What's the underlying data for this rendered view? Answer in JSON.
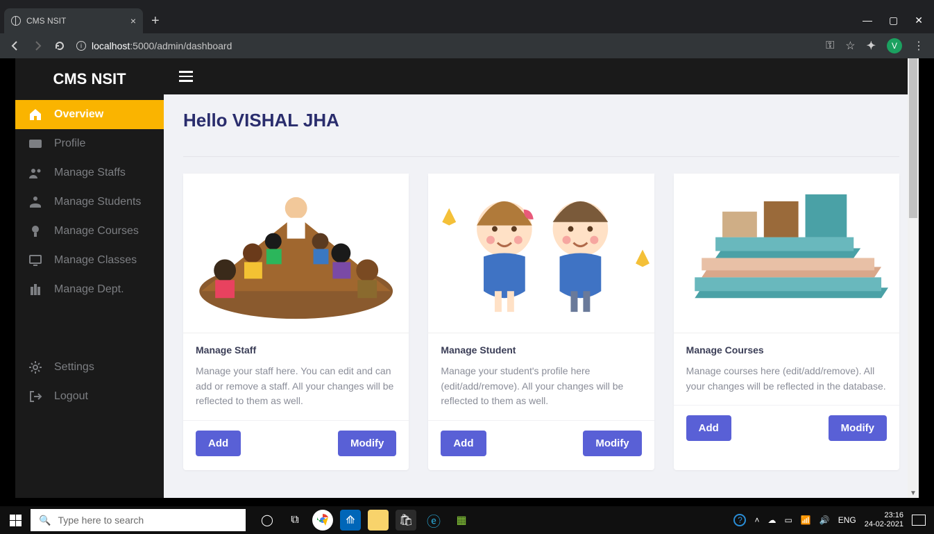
{
  "browser": {
    "tab_title": "CMS NSIT",
    "url_host": "localhost",
    "url_port_path": ":5000/admin/dashboard",
    "avatar_letter": "V"
  },
  "sidebar": {
    "brand": "CMS NSIT",
    "items": [
      {
        "label": "Overview"
      },
      {
        "label": "Profile"
      },
      {
        "label": "Manage Staffs"
      },
      {
        "label": "Manage Students"
      },
      {
        "label": "Manage Courses"
      },
      {
        "label": "Manage Classes"
      },
      {
        "label": "Manage Dept."
      }
    ],
    "footer_items": [
      {
        "label": "Settings"
      },
      {
        "label": "Logout"
      }
    ]
  },
  "main": {
    "greeting": "Hello VISHAL JHA",
    "cards": [
      {
        "title": "Manage Staff",
        "text": "Manage your staff here. You can edit and can add or remove a staff. All your changes will be reflected to them as well.",
        "add_label": "Add",
        "modify_label": "Modify"
      },
      {
        "title": "Manage Student",
        "text": "Manage your student's profile here (edit/add/remove). All your changes will be reflected to them as well.",
        "add_label": "Add",
        "modify_label": "Modify"
      },
      {
        "title": "Manage Courses",
        "text": "Manage courses here (edit/add/remove). All your changes will be reflected in the database.",
        "add_label": "Add",
        "modify_label": "Modify"
      }
    ]
  },
  "taskbar": {
    "search_placeholder": "Type here to search",
    "lang": "ENG",
    "time": "23:16",
    "date": "24-02-2021"
  }
}
